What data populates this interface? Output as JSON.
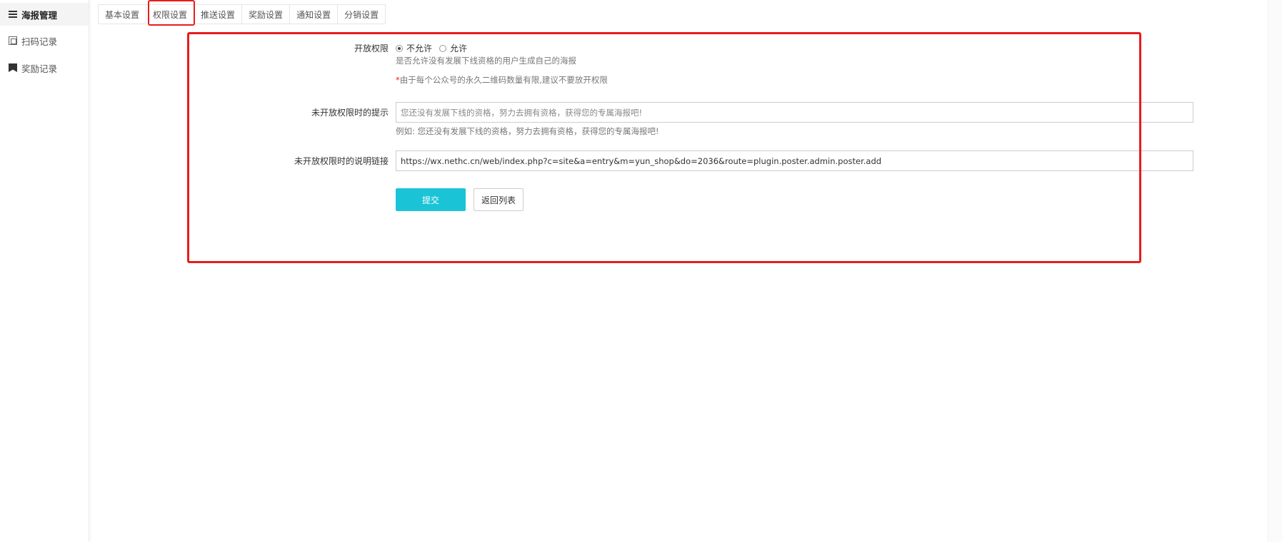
{
  "sidebar": {
    "items": [
      {
        "label": "海报管理",
        "icon": "list-icon",
        "active": true
      },
      {
        "label": "扫码记录",
        "icon": "qrcode-icon",
        "active": false
      },
      {
        "label": "奖励记录",
        "icon": "bookmark-icon",
        "active": false
      }
    ]
  },
  "tabs": [
    {
      "label": "基本设置"
    },
    {
      "label": "权限设置",
      "active": true
    },
    {
      "label": "推送设置"
    },
    {
      "label": "奖励设置"
    },
    {
      "label": "通知设置"
    },
    {
      "label": "分销设置"
    }
  ],
  "form": {
    "permission": {
      "label": "开放权限",
      "options": [
        {
          "label": "不允许",
          "checked": true
        },
        {
          "label": "允许",
          "checked": false
        }
      ],
      "help": "是否允许没有发展下线资格的用户生成自己的海报",
      "warning_star": "*",
      "warning": "由于每个公众号的永久二维码数量有限,建议不要放开权限"
    },
    "tip": {
      "label": "未开放权限时的提示",
      "placeholder": "您还没有发展下线的资格，努力去拥有资格，获得您的专属海报吧!",
      "help": "例如: 您还没有发展下线的资格，努力去拥有资格，获得您的专属海报吧!"
    },
    "link": {
      "label": "未开放权限时的说明链接",
      "value": "https://wx.nethc.cn/web/index.php?c=site&a=entry&m=yun_shop&do=2036&route=plugin.poster.admin.poster.add"
    },
    "submit_label": "提交",
    "back_label": "返回列表"
  },
  "colors": {
    "accent": "#1ac4d6",
    "highlight": "#e81c1c"
  }
}
